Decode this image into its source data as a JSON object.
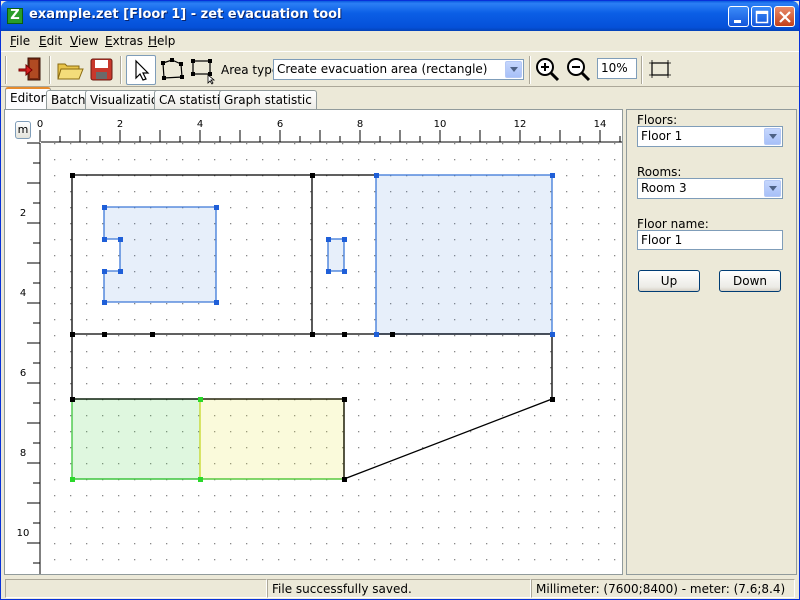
{
  "window": {
    "title": "example.zet [Floor 1] - zet evacuation tool",
    "app_icon_letter": "Z"
  },
  "menu": [
    {
      "mnemonic": "F",
      "rest": "ile"
    },
    {
      "mnemonic": "E",
      "rest": "dit"
    },
    {
      "mnemonic": "V",
      "rest": "iew"
    },
    {
      "mnemonic": "E",
      "rest": "xtras"
    },
    {
      "mnemonic": "H",
      "rest": "elp"
    }
  ],
  "toolbar": {
    "area_type_label": "Area type:",
    "area_type_value": "Create evacuation area (rectangle)",
    "zoom_value": "10%"
  },
  "tabs": [
    "Editor",
    "Batch",
    "Visualization",
    "CA statistic",
    "Graph statistic"
  ],
  "editor": {
    "unit_button": "m",
    "ruler_x_labels": [
      "0",
      "2",
      "4",
      "6",
      "8",
      "10",
      "12",
      "14"
    ],
    "ruler_y_labels": [
      "2",
      "4",
      "6",
      "8",
      "10"
    ],
    "colors": {
      "evacuation_area": "#3c78d8",
      "assignment_area": "#4cd44c",
      "save_area": "#e6e64c"
    }
  },
  "panel": {
    "floors_label": "Floors:",
    "floors_value": "Floor 1",
    "rooms_label": "Rooms:",
    "rooms_value": "Room 3",
    "floor_name_label": "Floor name:",
    "floor_name_value": "Floor 1",
    "up_button": "Up",
    "down_button": "Down"
  },
  "status": {
    "left": "",
    "message": "File successfully saved.",
    "coordinates": "Millimeter: (7600;8400) - meter: (7.6;8.4)"
  }
}
